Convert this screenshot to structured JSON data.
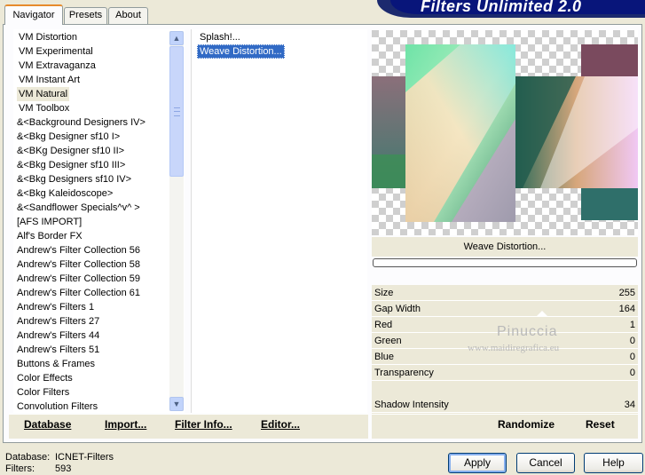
{
  "banner": {
    "title": "Filters Unlimited 2.0"
  },
  "tabs": [
    {
      "label": "Navigator",
      "active": true
    },
    {
      "label": "Presets",
      "active": false
    },
    {
      "label": "About",
      "active": false
    }
  ],
  "categories": [
    {
      "label": "VM Distortion"
    },
    {
      "label": "VM Experimental"
    },
    {
      "label": "VM Extravaganza"
    },
    {
      "label": "VM Instant Art"
    },
    {
      "label": "VM Natural",
      "selected": true
    },
    {
      "label": "VM Toolbox"
    },
    {
      "label": "&<Background Designers IV>"
    },
    {
      "label": "&<Bkg Designer sf10 I>"
    },
    {
      "label": "&<BKg Designer sf10 II>"
    },
    {
      "label": "&<Bkg Designer sf10 III>"
    },
    {
      "label": "&<Bkg Designers sf10 IV>"
    },
    {
      "label": "&<Bkg Kaleidoscope>"
    },
    {
      "label": "&<Sandflower Specials^v^ >"
    },
    {
      "label": "[AFS IMPORT]"
    },
    {
      "label": "Alf's Border FX"
    },
    {
      "label": "Andrew's Filter Collection 56"
    },
    {
      "label": "Andrew's Filter Collection 58"
    },
    {
      "label": "Andrew's Filter Collection 59"
    },
    {
      "label": "Andrew's Filter Collection 61"
    },
    {
      "label": "Andrew's Filters 1"
    },
    {
      "label": "Andrew's Filters 27"
    },
    {
      "label": "Andrew's Filters 44"
    },
    {
      "label": "Andrew's Filters 51"
    },
    {
      "label": "Buttons & Frames"
    },
    {
      "label": "Color Effects"
    },
    {
      "label": "Color Filters"
    },
    {
      "label": "Convolution Filters"
    }
  ],
  "filters": [
    {
      "label": "Splash!..."
    },
    {
      "label": "Weave Distortion...",
      "selected": true
    }
  ],
  "preview": {
    "label": "Weave Distortion..."
  },
  "params": [
    {
      "label": "Size",
      "value": "255"
    },
    {
      "label": "Gap Width",
      "value": "164"
    },
    {
      "label": "Red",
      "value": "1"
    },
    {
      "label": "Green",
      "value": "0"
    },
    {
      "label": "Blue",
      "value": "0"
    },
    {
      "label": "Transparency",
      "value": "0"
    },
    {
      "label": "Shadow Intensity",
      "value": "34"
    }
  ],
  "watermark": {
    "name": "Pinuccia",
    "site": "www.maidiregrafica.eu"
  },
  "left_buttons": {
    "database": "Database",
    "import": "Import...",
    "filter_info": "Filter Info...",
    "editor": "Editor..."
  },
  "right_buttons": {
    "randomize": "Randomize",
    "reset": "Reset"
  },
  "footer": {
    "database_label": "Database:",
    "database_value": "ICNET-Filters",
    "filters_label": "Filters:",
    "filters_value": "593",
    "apply": "Apply",
    "cancel": "Cancel",
    "help": "Help"
  },
  "icons": {
    "scroll_up": "chevron-up-icon",
    "scroll_down": "chevron-down-icon"
  }
}
